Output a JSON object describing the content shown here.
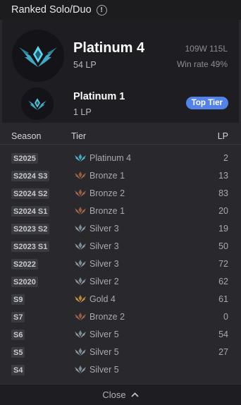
{
  "header": {
    "title": "Ranked Solo/Duo",
    "info_icon": "info-icon"
  },
  "current": {
    "tier": "Platinum 4",
    "lp": "54 LP",
    "record": "109W 115L",
    "win_rate": "Win rate 49%",
    "emblem": "platinum-emblem-icon"
  },
  "peak": {
    "tier": "Platinum 1",
    "lp": "1 LP",
    "badge": "Top Tier",
    "emblem": "platinum-emblem-icon"
  },
  "table": {
    "headers": {
      "season": "Season",
      "tier": "Tier",
      "lp": "LP"
    },
    "rows": [
      {
        "season": "S2025",
        "tier": "Platinum 4",
        "lp": "2"
      },
      {
        "season": "S2024 S3",
        "tier": "Bronze 1",
        "lp": "13"
      },
      {
        "season": "S2024 S2",
        "tier": "Bronze 2",
        "lp": "83"
      },
      {
        "season": "S2024 S1",
        "tier": "Bronze 1",
        "lp": "20"
      },
      {
        "season": "S2023 S2",
        "tier": "Silver 3",
        "lp": "19"
      },
      {
        "season": "S2023 S1",
        "tier": "Silver 3",
        "lp": "50"
      },
      {
        "season": "S2022",
        "tier": "Silver 3",
        "lp": "72"
      },
      {
        "season": "S2020",
        "tier": "Silver 2",
        "lp": "62"
      },
      {
        "season": "S9",
        "tier": "Gold 4",
        "lp": "61"
      },
      {
        "season": "S7",
        "tier": "Bronze 2",
        "lp": "0"
      },
      {
        "season": "S6",
        "tier": "Silver 5",
        "lp": "54"
      },
      {
        "season": "S5",
        "tier": "Silver 5",
        "lp": "27"
      },
      {
        "season": "S4",
        "tier": "Silver 5",
        "lp": ""
      }
    ]
  },
  "tier_colors": {
    "Platinum": "#4fb5c9",
    "Bronze": "#a5674a",
    "Silver": "#8a9aa3",
    "Gold": "#c8953f"
  },
  "accent": "#5383e8",
  "footer": {
    "close_label": "Close",
    "chevron_icon": "chevron-up-icon"
  }
}
